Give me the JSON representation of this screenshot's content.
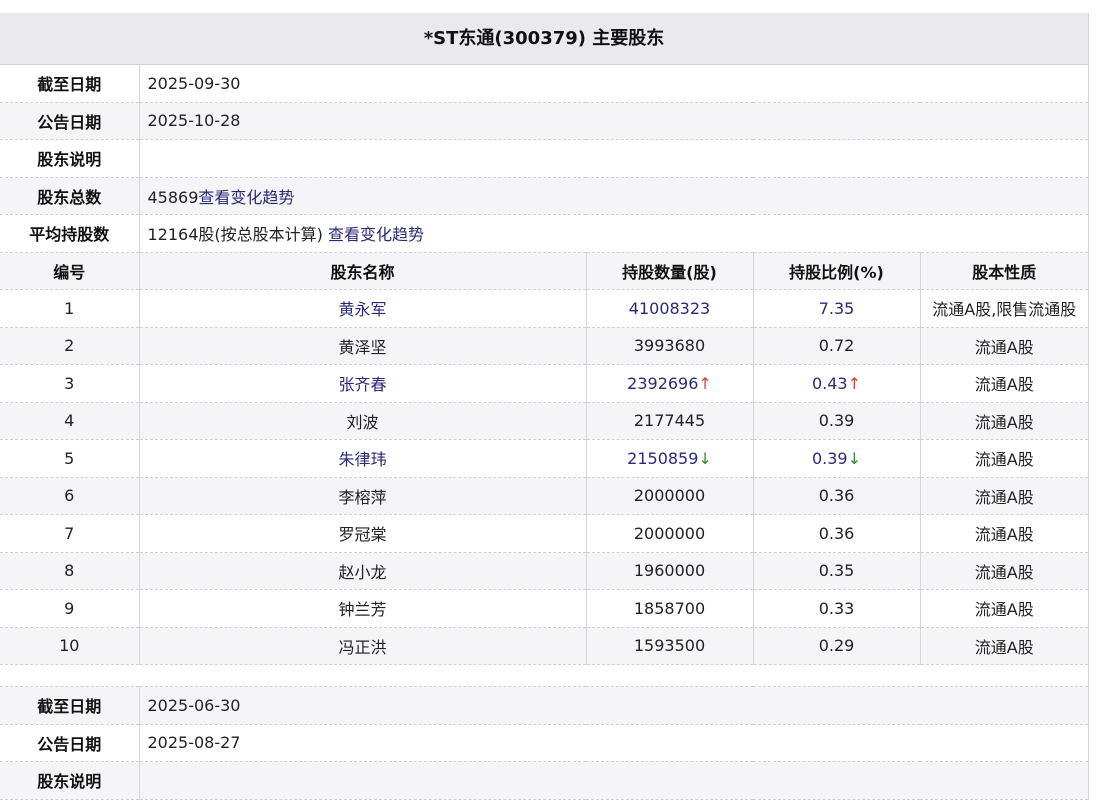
{
  "title": "*ST东通(300379)  主要股东",
  "colors": {
    "link": "#2a2a78",
    "up": "#d0463c",
    "down": "#2e8b3e"
  },
  "report1": {
    "labels": {
      "end_date": "截至日期",
      "announce_date": "公告日期",
      "note": "股东说明",
      "total": "股东总数",
      "avg": "平均持股数"
    },
    "end_date": "2025-09-30",
    "announce_date": "2025-10-28",
    "note": "",
    "total_holders": "45869",
    "trend_link": "查看变化趋势",
    "avg_shares": "12164股(按总股本计算) ",
    "headers": [
      "编号",
      "股东名称",
      "持股数量(股)",
      "持股比例(%)",
      "股本性质"
    ],
    "holders": [
      {
        "no": "1",
        "name": "黄永军",
        "shares": "41008323",
        "ratio": "7.35",
        "type": "流通A股,限售流通股",
        "link": true,
        "change": ""
      },
      {
        "no": "2",
        "name": "黄泽坚",
        "shares": "3993680",
        "ratio": "0.72",
        "type": "流通A股",
        "link": false,
        "change": ""
      },
      {
        "no": "3",
        "name": "张齐春",
        "shares": "2392696",
        "ratio": "0.43",
        "type": "流通A股",
        "link": true,
        "change": "↑"
      },
      {
        "no": "4",
        "name": "刘波",
        "shares": "2177445",
        "ratio": "0.39",
        "type": "流通A股",
        "link": false,
        "change": ""
      },
      {
        "no": "5",
        "name": "朱律玮",
        "shares": "2150859",
        "ratio": "0.39",
        "type": "流通A股",
        "link": true,
        "change": "↓"
      },
      {
        "no": "6",
        "name": "李榕萍",
        "shares": "2000000",
        "ratio": "0.36",
        "type": "流通A股",
        "link": false,
        "change": ""
      },
      {
        "no": "7",
        "name": "罗冠棠",
        "shares": "2000000",
        "ratio": "0.36",
        "type": "流通A股",
        "link": false,
        "change": ""
      },
      {
        "no": "8",
        "name": "赵小龙",
        "shares": "1960000",
        "ratio": "0.35",
        "type": "流通A股",
        "link": false,
        "change": ""
      },
      {
        "no": "9",
        "name": "钟兰芳",
        "shares": "1858700",
        "ratio": "0.33",
        "type": "流通A股",
        "link": false,
        "change": ""
      },
      {
        "no": "10",
        "name": "冯正洪",
        "shares": "1593500",
        "ratio": "0.29",
        "type": "流通A股",
        "link": false,
        "change": ""
      }
    ]
  },
  "report2": {
    "end_date": "2025-06-30",
    "announce_date": "2025-08-27",
    "note": ""
  }
}
